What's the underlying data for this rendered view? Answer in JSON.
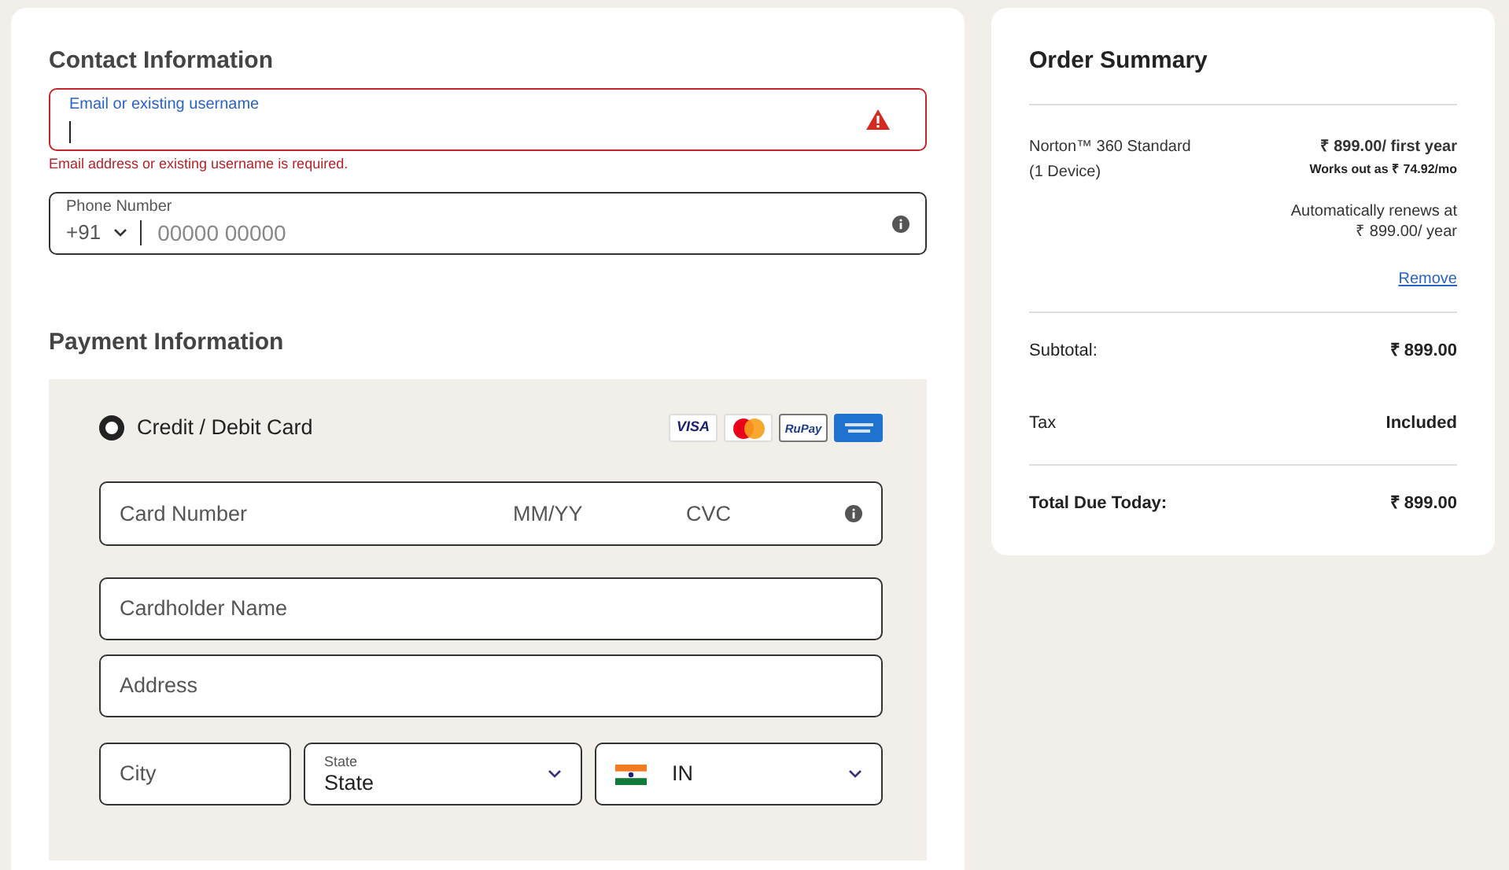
{
  "contact": {
    "title": "Contact Information",
    "email": {
      "label": "Email or existing username",
      "invalid": true,
      "error": "Email address or existing username is required."
    },
    "phone": {
      "label": "Phone Number",
      "country_code": "+91",
      "placeholder": "00000 00000"
    }
  },
  "payment": {
    "title": "Payment Information",
    "method": {
      "label": "Credit / Debit Card",
      "selected": true
    },
    "brands": [
      {
        "kind": "visa",
        "label": "VISA"
      },
      {
        "kind": "mastercard"
      },
      {
        "kind": "rupay",
        "label": "RuPay"
      },
      {
        "kind": "amex"
      }
    ],
    "card_number": {
      "placeholder": "Card Number"
    },
    "expiry": {
      "placeholder": "MM/YY"
    },
    "cvc": {
      "placeholder": "CVC"
    },
    "cardholder": {
      "placeholder": "Cardholder Name"
    },
    "address": {
      "placeholder": "Address"
    },
    "city": {
      "placeholder": "City"
    },
    "state": {
      "label": "State",
      "value": "State"
    },
    "country": {
      "value": "IN"
    }
  },
  "summary": {
    "title": "Order Summary",
    "product": {
      "name": "Norton™ 360 Standard",
      "detail": "(1 Device)",
      "price": "₹ 899.00/ first year",
      "monthly": "Works out as ₹ 74.92/mo",
      "renewal": "Automatically renews at",
      "renewal_price": "₹ 899.00/ year",
      "remove": "Remove"
    },
    "rows": [
      {
        "kind": "line",
        "label": "Subtotal:",
        "value": "₹ 899.00"
      },
      {
        "kind": "line",
        "label": "Tax",
        "value": "Included"
      },
      {
        "kind": "total",
        "label": "Total Due Today:",
        "value": "₹ 899.00"
      }
    ]
  }
}
